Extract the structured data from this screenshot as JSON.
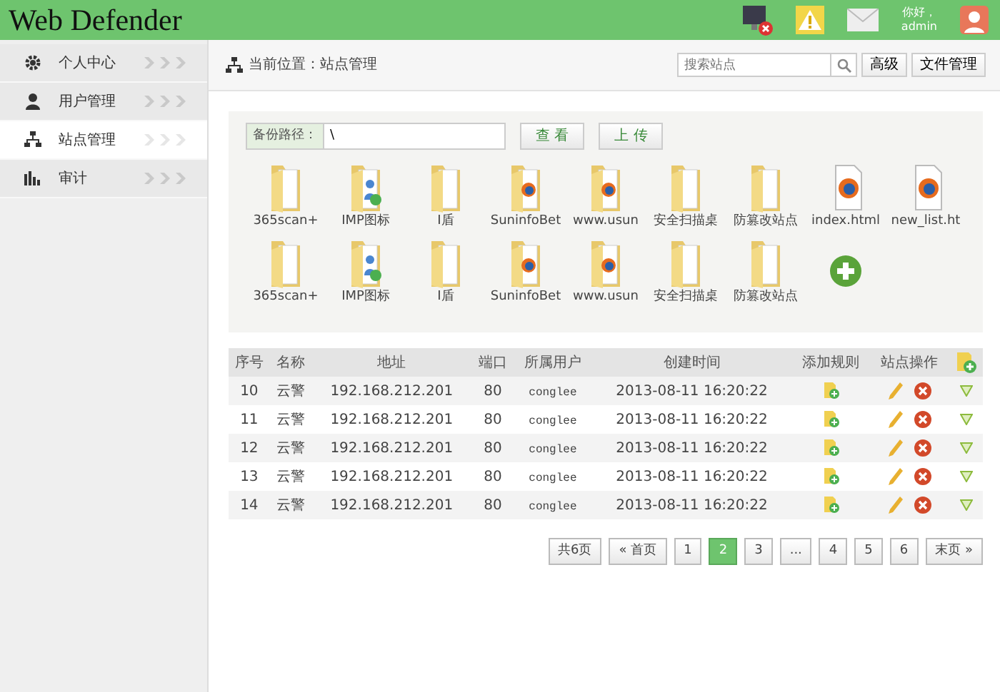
{
  "header": {
    "title": "Web Defender",
    "greeting": "你好，",
    "user": "admin"
  },
  "sidebar": {
    "items": [
      {
        "label": "个人中心",
        "kind": "gear",
        "selected": false
      },
      {
        "label": "用户管理",
        "kind": "user",
        "selected": false
      },
      {
        "label": "站点管理",
        "kind": "sitemap",
        "selected": true
      },
      {
        "label": "审计",
        "kind": "chart",
        "selected": false
      }
    ]
  },
  "breadcrumb": "当前位置：站点管理",
  "search": {
    "placeholder": "搜索站点"
  },
  "toolbar_buttons": [
    "高级",
    "文件管理"
  ],
  "backup": {
    "label": "备份路径：",
    "value": "\\",
    "buttons": [
      "查 看",
      "上 传"
    ]
  },
  "files": [
    {
      "name": "365scan+",
      "kind": "folder"
    },
    {
      "name": "IMP图标",
      "kind": "user-folder"
    },
    {
      "name": "I盾",
      "kind": "folder"
    },
    {
      "name": "SuninfoBet",
      "kind": "web-folder"
    },
    {
      "name": "www.usun",
      "kind": "web-folder"
    },
    {
      "name": "安全扫描桌",
      "kind": "folder"
    },
    {
      "name": "防篡改站点",
      "kind": "folder"
    },
    {
      "name": "index.html",
      "kind": "web-file"
    },
    {
      "name": "new_list.ht",
      "kind": "web-file"
    },
    {
      "name": "365scan+",
      "kind": "folder"
    },
    {
      "name": "IMP图标",
      "kind": "user-folder"
    },
    {
      "name": "I盾",
      "kind": "folder"
    },
    {
      "name": "SuninfoBet",
      "kind": "web-folder"
    },
    {
      "name": "www.usun",
      "kind": "web-folder"
    },
    {
      "name": "安全扫描桌",
      "kind": "folder"
    },
    {
      "name": "防篡改站点",
      "kind": "folder"
    }
  ],
  "table": {
    "columns": [
      "序号",
      "名称",
      "地址",
      "端口",
      "所属用户",
      "创建时间",
      "添加规则",
      "站点操作"
    ],
    "rows": [
      {
        "id": "10",
        "name": "云警",
        "address": "192.168.212.201",
        "port": "80",
        "user": "conglee",
        "created": "2013-08-11 16:20:22"
      },
      {
        "id": "11",
        "name": "云警",
        "address": "192.168.212.201",
        "port": "80",
        "user": "conglee",
        "created": "2013-08-11 16:20:22"
      },
      {
        "id": "12",
        "name": "云警",
        "address": "192.168.212.201",
        "port": "80",
        "user": "conglee",
        "created": "2013-08-11 16:20:22"
      },
      {
        "id": "13",
        "name": "云警",
        "address": "192.168.212.201",
        "port": "80",
        "user": "conglee",
        "created": "2013-08-11 16:20:22"
      },
      {
        "id": "14",
        "name": "云警",
        "address": "192.168.212.201",
        "port": "80",
        "user": "conglee",
        "created": "2013-08-11 16:20:22"
      }
    ]
  },
  "pagination": [
    {
      "label": "共6页",
      "selected": false
    },
    {
      "label": "« 首页",
      "selected": false
    },
    {
      "label": "1",
      "selected": false
    },
    {
      "label": "2",
      "selected": true
    },
    {
      "label": "3",
      "selected": false
    },
    {
      "label": "...",
      "selected": false
    },
    {
      "label": "4",
      "selected": false
    },
    {
      "label": "5",
      "selected": false
    },
    {
      "label": "6",
      "selected": false
    },
    {
      "label": "末页 »",
      "selected": false
    }
  ]
}
